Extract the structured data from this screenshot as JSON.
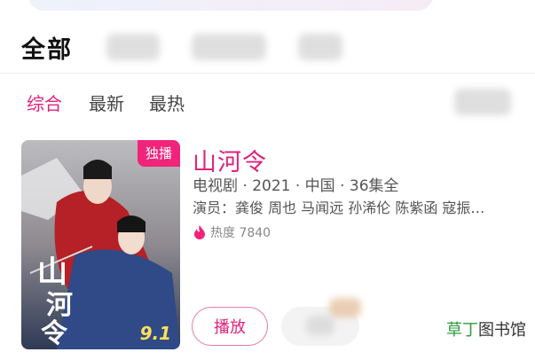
{
  "tabs": {
    "all": "全部"
  },
  "sort": {
    "items": [
      "综合",
      "最新",
      "最热"
    ],
    "active_index": 0
  },
  "card": {
    "badge": "独播",
    "score": "9.1",
    "title": "山河令",
    "meta": "电视剧 · 2021 · 中国 · 36集全",
    "cast": "演员：龚俊 周也 马闻远 孙浠伦 陈紫函 寇振…",
    "heat_label": "热度 7840",
    "play_label": "播放"
  },
  "watermark": {
    "green": "草丁",
    "rest": "图书馆"
  },
  "colors": {
    "accent": "#e0227a",
    "badge": "#f0247a",
    "score": "#ffe05a"
  }
}
